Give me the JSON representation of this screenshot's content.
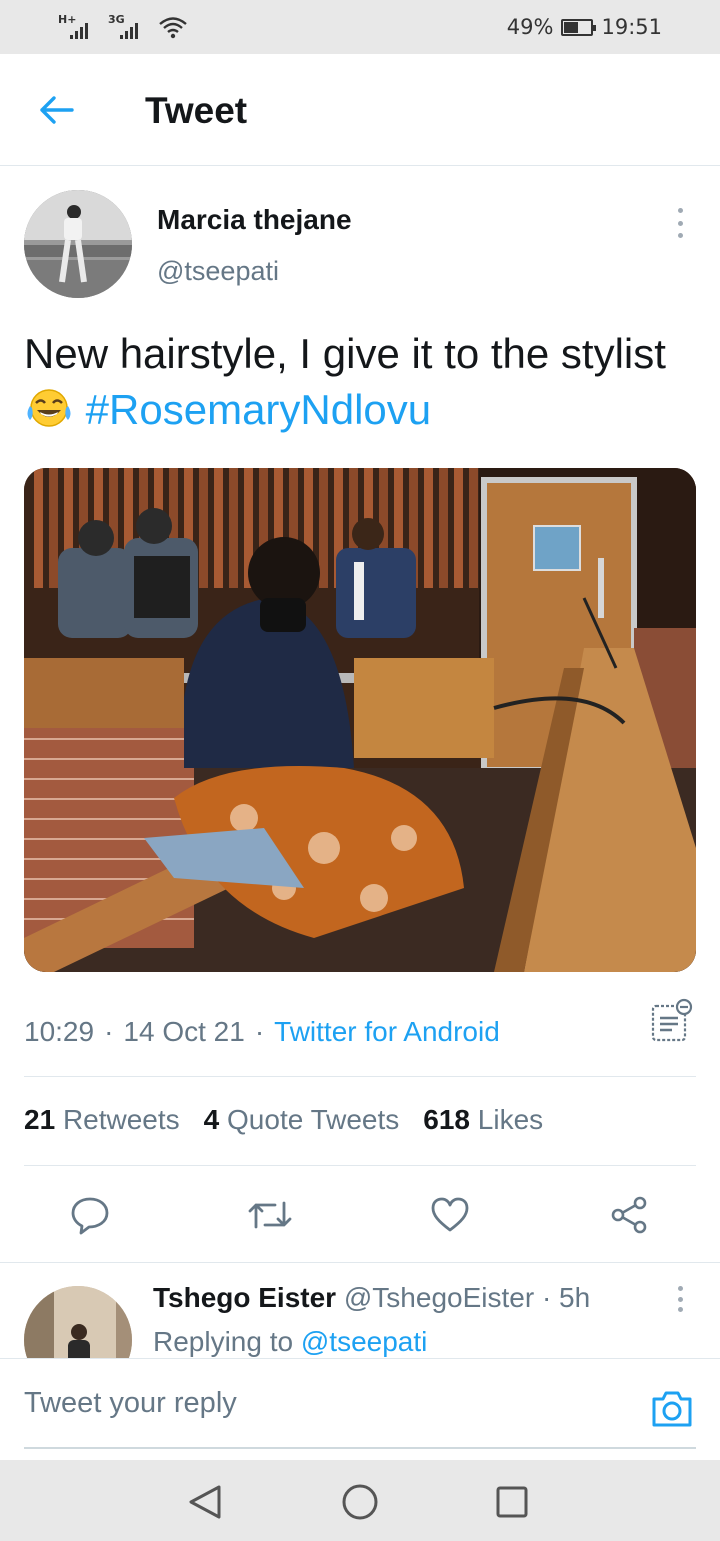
{
  "status_bar": {
    "network_1": "H+",
    "network_2": "3G",
    "battery_text": "49%",
    "battery_level": 0.49,
    "time": "19:51"
  },
  "header": {
    "title": "Tweet",
    "back_icon": "arrow-left-icon"
  },
  "tweet": {
    "author_name": "Marcia thejane",
    "author_handle": "@tseepati",
    "text_main": "New hairstyle, I give it to the stylist",
    "emoji": "face-with-tears-of-joy",
    "hashtag": "#RosemaryNdlovu",
    "time": "10:29",
    "date": "14 Oct 21",
    "separator": "·",
    "source": "Twitter for Android",
    "retweets_count": "21",
    "retweets_label": "Retweets",
    "quotes_count": "4",
    "quotes_label": "Quote Tweets",
    "likes_count": "618",
    "likes_label": "Likes"
  },
  "actions": {
    "reply_icon": "comment-icon",
    "retweet_icon": "retweet-icon",
    "like_icon": "heart-icon",
    "share_icon": "share-icon"
  },
  "reply": {
    "name": "Tshego Eister",
    "handle": "@TshegoEister",
    "age": "· 5h",
    "replying_prefix": "Replying to",
    "replying_to": "@tseepati"
  },
  "compose": {
    "placeholder": "Tweet your reply"
  },
  "colors": {
    "accent": "#1da1f2",
    "secondary_text": "#657786",
    "primary_text": "#14171a"
  }
}
